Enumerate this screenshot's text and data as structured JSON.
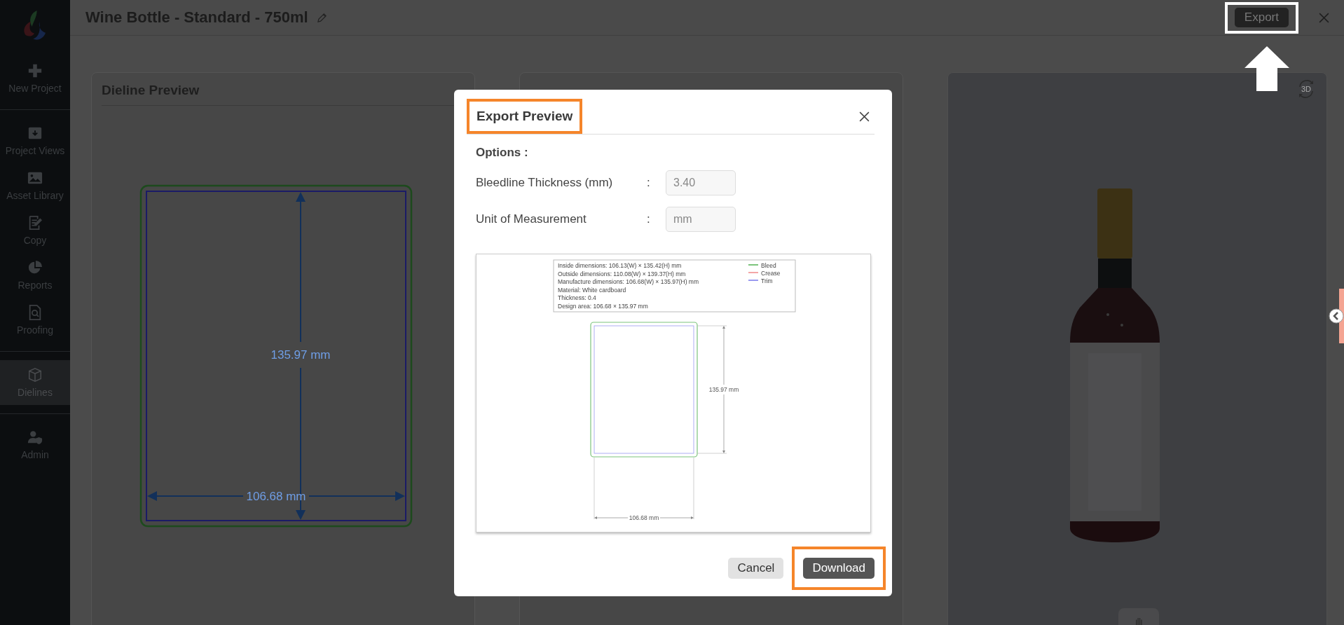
{
  "sidebar": {
    "sections": [
      [
        {
          "label": "New Project",
          "selected": false
        }
      ],
      [
        {
          "label": "Project Views",
          "selected": false
        },
        {
          "label": "Asset Library",
          "selected": false
        },
        {
          "label": "Copy",
          "selected": false
        },
        {
          "label": "Reports",
          "selected": false
        },
        {
          "label": "Proofing",
          "selected": false
        }
      ],
      [
        {
          "label": "Dielines",
          "selected": true
        }
      ],
      [
        {
          "label": "Admin",
          "selected": false
        }
      ]
    ]
  },
  "header": {
    "title": "Wine Bottle - Standard - 750ml",
    "export_button": {
      "label": "Export",
      "highlighted": true
    },
    "pointer_arrow": true
  },
  "dieline_card": {
    "title": "Dieline Preview",
    "height_label": "135.97 mm",
    "width_label": "106.68 mm"
  },
  "viewer_card": {
    "view_mode": "3D"
  },
  "modal": {
    "title": "Export Preview",
    "title_highlighted": true,
    "options_label": "Options :",
    "fields": [
      {
        "label": "Bleedline Thickness (mm)",
        "separator": ":",
        "value": "3.40"
      },
      {
        "label": "Unit of Measurement",
        "separator": ":",
        "value": "mm"
      }
    ],
    "preview": {
      "info_lines": [
        "Inside dimensions:   106.13(W) × 135.42(H) mm",
        "Outside dimensions:   110.08(W) × 139.37(H) mm",
        "Manufacture dimensions:   106.68(W) × 135.97(H) mm",
        "Material:   White cardboard",
        "Thickness:   0.4",
        "Design area:   106.68 × 135.97 mm"
      ],
      "legend": [
        {
          "label": "Bleed",
          "color": "#7cc47c"
        },
        {
          "label": "Crease",
          "color": "#f4a6a6"
        },
        {
          "label": "Trim",
          "color": "#9a9af0"
        }
      ],
      "height_label": "135.97 mm",
      "width_label": "106.68 mm"
    },
    "buttons": [
      {
        "label": "Cancel",
        "kind": "secondary",
        "highlighted": false
      },
      {
        "label": "Download",
        "kind": "primary",
        "highlighted": true
      }
    ]
  }
}
